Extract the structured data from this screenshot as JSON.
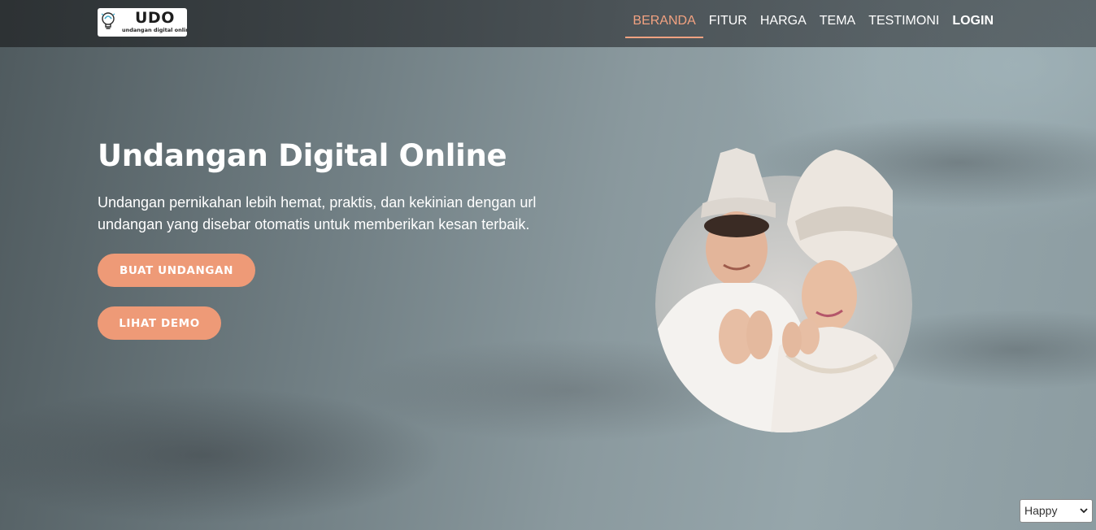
{
  "logo": {
    "title": "UDO",
    "subtitle": "undangan digital online"
  },
  "nav": {
    "items": [
      {
        "label": "BERANDA"
      },
      {
        "label": "FITUR"
      },
      {
        "label": "HARGA"
      },
      {
        "label": "TEMA"
      },
      {
        "label": "TESTIMONI"
      },
      {
        "label": "LOGIN"
      }
    ],
    "active_color": "#f2a281"
  },
  "hero": {
    "title": "Undangan Digital Online",
    "description": "Undangan pernikahan lebih hemat, praktis, dan kekinian dengan url undangan yang disebar otomatis untuk memberikan kesan terbaik.",
    "buttons": {
      "create": "BUAT UNDANGAN",
      "demo": "LIHAT DEMO"
    },
    "button_color": "#ee9a77"
  },
  "theme_select": {
    "value": "Happy"
  },
  "icons": {
    "logo": "lightbulb-icon",
    "select": "chevron-down-icon"
  }
}
